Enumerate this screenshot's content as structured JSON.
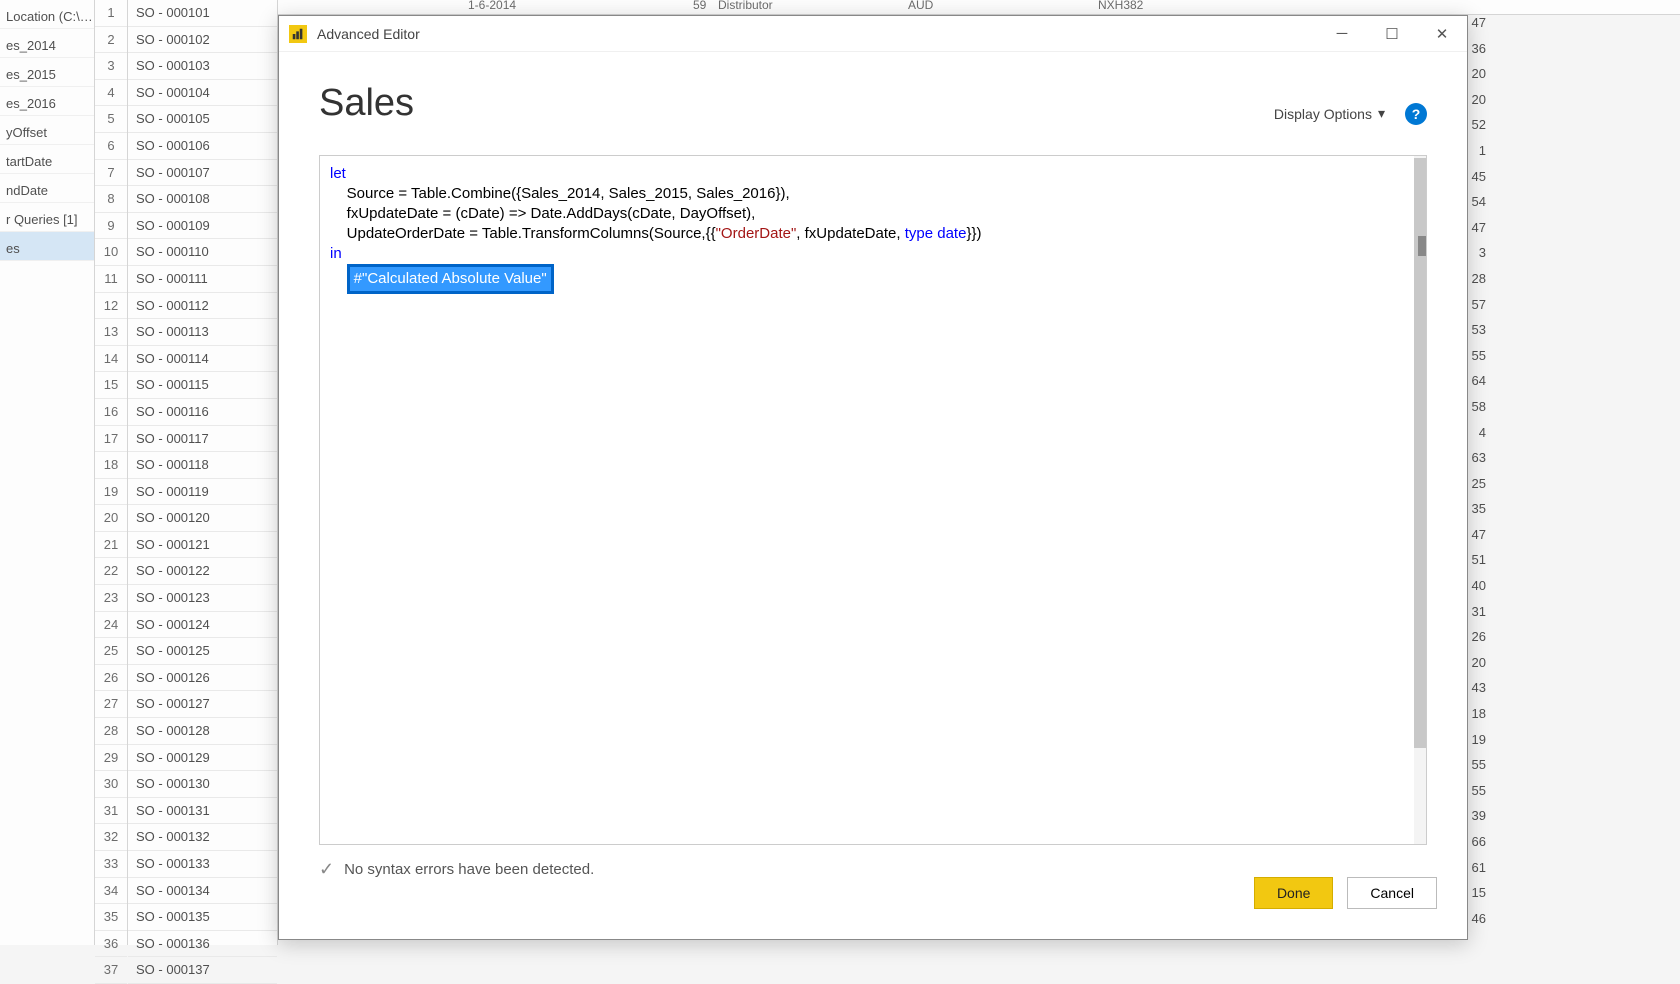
{
  "sidebar": {
    "items": [
      {
        "label": "Location (C:\\…"
      },
      {
        "label": "es_2014"
      },
      {
        "label": "es_2015"
      },
      {
        "label": "es_2016"
      },
      {
        "label": "yOffset"
      },
      {
        "label": "tartDate"
      },
      {
        "label": "ndDate"
      },
      {
        "label": "r Queries [1]"
      },
      {
        "label": "es"
      }
    ]
  },
  "bg_header": {
    "date": "1-6-2014",
    "qty": "59",
    "channel": "Distributor",
    "currency": "AUD",
    "code": "NXH382"
  },
  "bg_rows": [
    {
      "n": 1,
      "so": "SO - 000101",
      "v": 47
    },
    {
      "n": 2,
      "so": "SO - 000102",
      "v": 36
    },
    {
      "n": 3,
      "so": "SO - 000103",
      "v": 20
    },
    {
      "n": 4,
      "so": "SO - 000104",
      "v": 20
    },
    {
      "n": 5,
      "so": "SO - 000105",
      "v": 52
    },
    {
      "n": 6,
      "so": "SO - 000106",
      "v": 1
    },
    {
      "n": 7,
      "so": "SO - 000107",
      "v": 45
    },
    {
      "n": 8,
      "so": "SO - 000108",
      "v": 54
    },
    {
      "n": 9,
      "so": "SO - 000109",
      "v": 47
    },
    {
      "n": 10,
      "so": "SO - 000110",
      "v": 3
    },
    {
      "n": 11,
      "so": "SO - 000111",
      "v": 28
    },
    {
      "n": 12,
      "so": "SO - 000112",
      "v": 57
    },
    {
      "n": 13,
      "so": "SO - 000113",
      "v": 53
    },
    {
      "n": 14,
      "so": "SO - 000114",
      "v": 55
    },
    {
      "n": 15,
      "so": "SO - 000115",
      "v": 64
    },
    {
      "n": 16,
      "so": "SO - 000116",
      "v": 58
    },
    {
      "n": 17,
      "so": "SO - 000117",
      "v": 4
    },
    {
      "n": 18,
      "so": "SO - 000118",
      "v": 63
    },
    {
      "n": 19,
      "so": "SO - 000119",
      "v": 25
    },
    {
      "n": 20,
      "so": "SO - 000120",
      "v": 35
    },
    {
      "n": 21,
      "so": "SO - 000121",
      "v": 47
    },
    {
      "n": 22,
      "so": "SO - 000122",
      "v": 51
    },
    {
      "n": 23,
      "so": "SO - 000123",
      "v": 40
    },
    {
      "n": 24,
      "so": "SO - 000124",
      "v": 31
    },
    {
      "n": 25,
      "so": "SO - 000125",
      "v": 26
    },
    {
      "n": 26,
      "so": "SO - 000126",
      "v": 20
    },
    {
      "n": 27,
      "so": "SO - 000127",
      "v": 43
    },
    {
      "n": 28,
      "so": "SO - 000128",
      "v": 18
    },
    {
      "n": 29,
      "so": "SO - 000129",
      "v": 19
    },
    {
      "n": 30,
      "so": "SO - 000130",
      "v": 55
    },
    {
      "n": 31,
      "so": "SO - 000131",
      "v": 55
    },
    {
      "n": 32,
      "so": "SO - 000132",
      "v": 39
    },
    {
      "n": 33,
      "so": "SO - 000133",
      "v": 66
    },
    {
      "n": 34,
      "so": "SO - 000134",
      "v": 61
    },
    {
      "n": 35,
      "so": "SO - 000135",
      "v": 15
    },
    {
      "n": 36,
      "so": "SO - 000136",
      "v": 46
    },
    {
      "n": 37,
      "so": "SO - 000137",
      "v": ""
    }
  ],
  "dialog": {
    "title": "Advanced Editor",
    "query_name": "Sales",
    "display_options": "Display Options",
    "help": "?",
    "code": {
      "let": "let",
      "line1_a": "    Source = Table.Combine({Sales_2014, Sales_2015, Sales_2016}),",
      "line2_a": "    fxUpdateDate = (cDate) => Date.AddDays(cDate, DayOffset),",
      "line3_a": "    UpdateOrderDate = Table.TransformColumns(Source,{{",
      "line3_str": "\"OrderDate\"",
      "line3_b": ", fxUpdateDate, ",
      "line3_type": "type",
      "line3_date": " date",
      "line3_c": "}})",
      "in": "in",
      "selected": "#\"Calculated Absolute Value\""
    },
    "status": "No syntax errors have been detected.",
    "done": "Done",
    "cancel": "Cancel"
  }
}
